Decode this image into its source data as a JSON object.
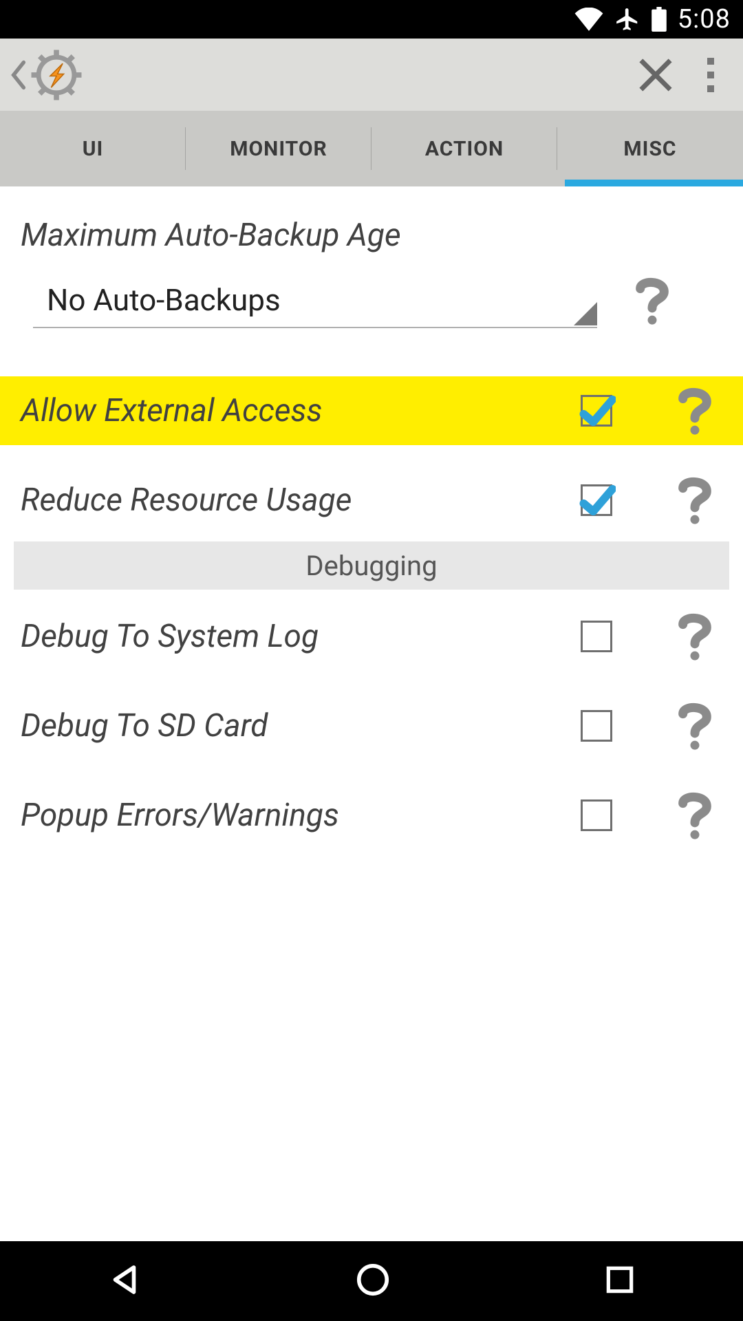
{
  "status": {
    "time": "5:08"
  },
  "tabs": {
    "items": [
      {
        "label": "UI"
      },
      {
        "label": "MONITOR"
      },
      {
        "label": "ACTION"
      },
      {
        "label": "MISC"
      }
    ],
    "active_index": 3
  },
  "settings": {
    "max_backup_age": {
      "title": "Maximum Auto-Backup Age",
      "value": "No Auto-Backups"
    },
    "allow_external_access": {
      "label": "Allow External Access",
      "checked": true,
      "highlighted": true
    },
    "reduce_resource_usage": {
      "label": "Reduce Resource Usage",
      "checked": true
    },
    "section_debugging": "Debugging",
    "debug_system_log": {
      "label": "Debug To System Log",
      "checked": false
    },
    "debug_sd_card": {
      "label": "Debug To SD Card",
      "checked": false
    },
    "popup_errors": {
      "label": "Popup Errors/Warnings",
      "checked": false
    }
  },
  "icons": {
    "back": "chevron-left",
    "app": "tasker-gear-lightning",
    "close": "x",
    "overflow": "vertical-dots",
    "wifi": "wifi",
    "airplane": "airplane",
    "battery": "battery",
    "help": "question",
    "nav_back": "triangle-left",
    "nav_home": "circle",
    "nav_recent": "square"
  },
  "colors": {
    "accent": "#2aa9e0",
    "highlight": "#ffee00",
    "check": "#2ea1d9"
  }
}
